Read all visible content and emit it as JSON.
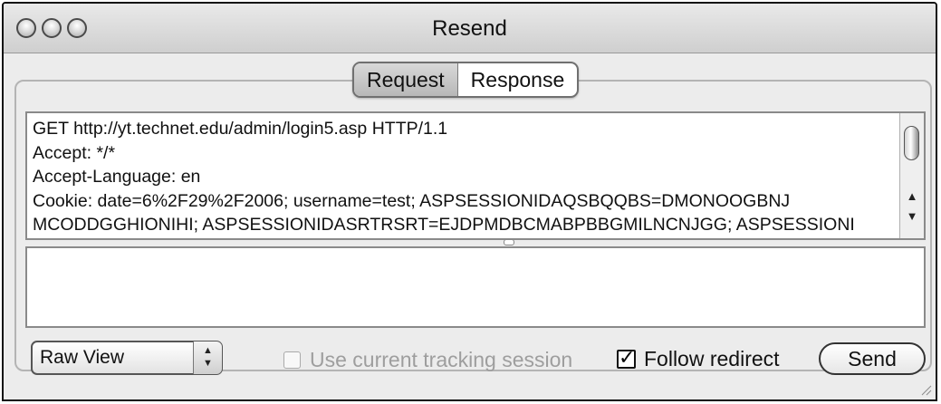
{
  "window": {
    "title": "Resend"
  },
  "tabs": [
    {
      "label": "Request",
      "selected": true
    },
    {
      "label": "Response",
      "selected": false
    }
  ],
  "request": {
    "lines": [
      "GET http://yt.technet.edu/admin/login5.asp HTTP/1.1",
      "Accept: */*",
      "Accept-Language: en",
      "Cookie: date=6%2F29%2F2006; username=test; ASPSESSIONIDAQSBQQBS=DMONOOGBNJ",
      "MCODDGGHIONIHI; ASPSESSIONIDASRTRSRT=EJDPMDBCMABPBBGMILNCNJGG; ASPSESSIONI"
    ]
  },
  "response": {
    "body": ""
  },
  "footer": {
    "view_select": "Raw View",
    "tracking_label": "Use current tracking session",
    "tracking_checked": false,
    "tracking_enabled": false,
    "redirect_label": "Follow redirect",
    "redirect_checked": true,
    "send_label": "Send"
  },
  "icons": {
    "close": "close-icon",
    "minimize": "minimize-icon",
    "zoom": "zoom-icon",
    "scroll_up": "scroll-up-icon",
    "scroll_down": "scroll-down-icon",
    "stepper": "stepper-icon",
    "checkmark": "checkmark-icon",
    "resize_grip": "resize-grip-icon"
  }
}
